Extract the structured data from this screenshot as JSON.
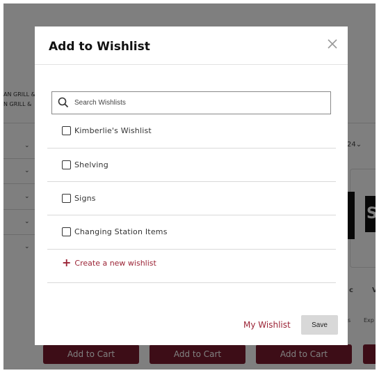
{
  "background": {
    "side_texts": [
      "AN GRILL &",
      "N GRILL &"
    ],
    "sort_suffix": "24",
    "card_letter": "S",
    "card_small": [
      "c",
      "V"
    ],
    "card_tiny": [
      "s",
      "Exp"
    ],
    "add_to_cart_label": "Add to Cart"
  },
  "modal": {
    "title": "Add to Wishlist",
    "search_placeholder": "Search Wishlists",
    "wishlists": [
      {
        "label": "Kimberlie's Wishlist",
        "checked": false
      },
      {
        "label": "Shelving",
        "checked": false
      },
      {
        "label": "Signs",
        "checked": false
      },
      {
        "label": "Changing Station Items",
        "checked": false
      }
    ],
    "create_label": "Create a new wishlist",
    "my_wishlist_label": "My Wishlist",
    "save_label": "Save"
  },
  "colors": {
    "accent": "#9b2335",
    "cart_button": "#7a1b2e",
    "overlay": "rgba(0,0,0,0.5)"
  }
}
